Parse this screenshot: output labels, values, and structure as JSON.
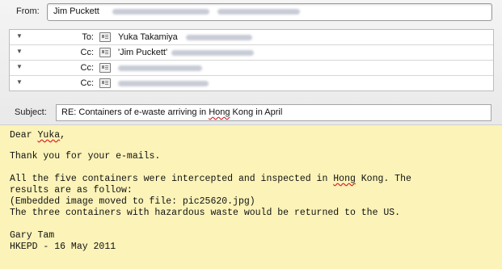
{
  "header": {
    "from_label": "From:",
    "from_name": "Jim Puckett",
    "recipients": [
      {
        "label": "To:",
        "name": "Yuka Takamiya"
      },
      {
        "label": "Cc:",
        "name": "'Jim Puckett'"
      },
      {
        "label": "Cc:",
        "name": ""
      },
      {
        "label": "Cc:",
        "name": ""
      }
    ],
    "subject_label": "Subject:",
    "subject": {
      "before": "RE: Containers of e-waste arriving in ",
      "underlined": "Hong",
      "after": " Kong in April"
    }
  },
  "body": {
    "greeting_prefix": "Dear ",
    "greeting_name": "Yuka",
    "greeting_suffix": ",",
    "thanks": "Thank you for your e-mails.",
    "para1_before": "All the five containers were intercepted and inspected in ",
    "para1_underlined": "Hong",
    "para1_after": " Kong. The",
    "para1_line2": "results are as follow:",
    "para1_line3": "(Embedded image moved to file: pic25620.jpg)",
    "para1_line4": "The three containers with hazardous waste would be returned to the US.",
    "sig_name": "Gary Tam",
    "sig_line": "HKEPD - 16 May 2011"
  }
}
